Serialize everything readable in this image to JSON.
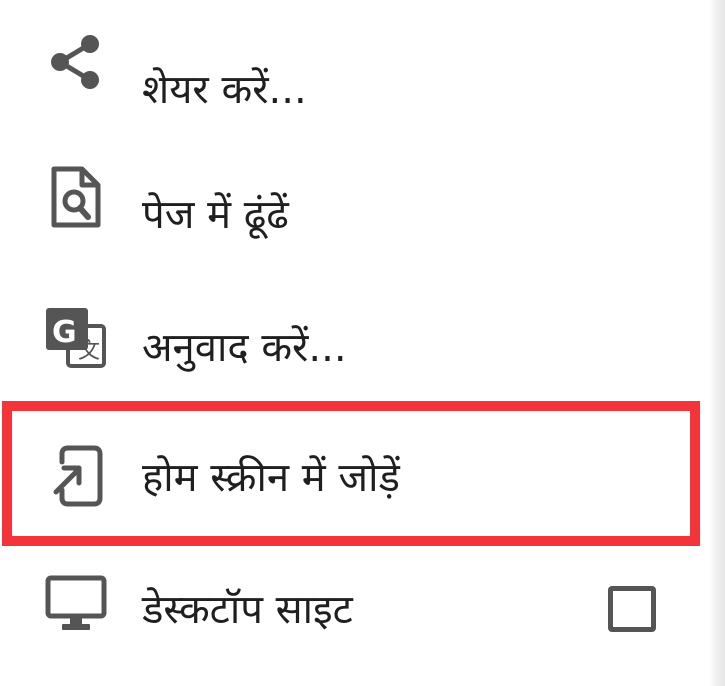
{
  "menu": {
    "items": [
      {
        "id": "share",
        "icon": "share-icon",
        "label": "शेयर करें..."
      },
      {
        "id": "find",
        "icon": "find-in-page-icon",
        "label": "पेज में ढूंढें"
      },
      {
        "id": "translate",
        "icon": "translate-icon",
        "label": "अनुवाद करें..."
      },
      {
        "id": "home",
        "icon": "add-to-home-screen-icon",
        "label": "होम स्क्रीन में जोड़ें"
      },
      {
        "id": "desktop",
        "icon": "desktop-icon",
        "label": "डेस्कटॉप साइट",
        "checkbox_checked": false
      }
    ]
  },
  "colors": {
    "highlight_border": "#f3343a",
    "icon": "#555555",
    "text": "#1f1f1f"
  }
}
